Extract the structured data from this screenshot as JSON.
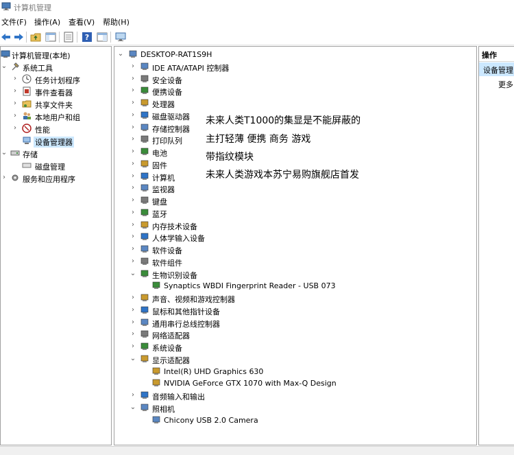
{
  "window": {
    "title": "计算机管理"
  },
  "menu": {
    "file": "文件(F)",
    "action": "操作(A)",
    "view": "查看(V)",
    "help": "帮助(H)"
  },
  "left_tree": {
    "root": "计算机管理(本地)",
    "system_tools": "系统工具",
    "task_scheduler": "任务计划程序",
    "event_viewer": "事件查看器",
    "shared_folders": "共享文件夹",
    "local_users": "本地用户和组",
    "performance": "性能",
    "device_manager": "设备管理器",
    "storage": "存储",
    "disk_management": "磁盘管理",
    "services_apps": "服务和应用程序"
  },
  "device_tree": {
    "root": "DESKTOP-RAT1S9H",
    "categories": [
      {
        "label": "IDE ATA/ATAPI 控制器",
        "expanded": false,
        "icon": "ide-controller-icon"
      },
      {
        "label": "安全设备",
        "expanded": false,
        "icon": "security-device-icon"
      },
      {
        "label": "便携设备",
        "expanded": false,
        "icon": "portable-device-icon"
      },
      {
        "label": "处理器",
        "expanded": false,
        "icon": "processor-icon"
      },
      {
        "label": "磁盘驱动器",
        "expanded": false,
        "icon": "disk-drive-icon"
      },
      {
        "label": "存储控制器",
        "expanded": false,
        "icon": "storage-controller-icon"
      },
      {
        "label": "打印队列",
        "expanded": false,
        "icon": "printer-icon"
      },
      {
        "label": "电池",
        "expanded": false,
        "icon": "battery-icon"
      },
      {
        "label": "固件",
        "expanded": false,
        "icon": "firmware-icon"
      },
      {
        "label": "计算机",
        "expanded": false,
        "icon": "computer-icon"
      },
      {
        "label": "监视器",
        "expanded": false,
        "icon": "monitor-icon"
      },
      {
        "label": "键盘",
        "expanded": false,
        "icon": "keyboard-icon"
      },
      {
        "label": "蓝牙",
        "expanded": false,
        "icon": "bluetooth-icon"
      },
      {
        "label": "内存技术设备",
        "expanded": false,
        "icon": "memory-device-icon"
      },
      {
        "label": "人体学输入设备",
        "expanded": false,
        "icon": "hid-icon"
      },
      {
        "label": "软件设备",
        "expanded": false,
        "icon": "software-device-icon"
      },
      {
        "label": "软件组件",
        "expanded": false,
        "icon": "software-component-icon"
      },
      {
        "label": "生物识别设备",
        "expanded": true,
        "icon": "biometric-icon",
        "children": [
          "Synaptics WBDI Fingerprint Reader - USB 073"
        ]
      },
      {
        "label": "声音、视频和游戏控制器",
        "expanded": false,
        "icon": "sound-icon"
      },
      {
        "label": "鼠标和其他指针设备",
        "expanded": false,
        "icon": "mouse-icon"
      },
      {
        "label": "通用串行总线控制器",
        "expanded": false,
        "icon": "usb-icon"
      },
      {
        "label": "网络适配器",
        "expanded": false,
        "icon": "network-adapter-icon"
      },
      {
        "label": "系统设备",
        "expanded": false,
        "icon": "system-device-icon"
      },
      {
        "label": "显示适配器",
        "expanded": true,
        "icon": "display-adapter-icon",
        "children": [
          "Intel(R) UHD Graphics 630",
          "NVIDIA GeForce GTX 1070 with Max-Q Design"
        ]
      },
      {
        "label": "音频输入和输出",
        "expanded": false,
        "icon": "audio-io-icon"
      },
      {
        "label": "照相机",
        "expanded": true,
        "icon": "camera-icon",
        "children": [
          "Chicony USB 2.0 Camera"
        ]
      }
    ]
  },
  "overlay_text": [
    "未来人类T1000的集显是不能屏蔽的",
    "主打轻薄 便携 商务 游戏",
    "带指纹模块",
    "未来人类游戏本苏宁易购旗舰店首发"
  ],
  "actions_panel": {
    "header": "操作",
    "selected": "设备管理",
    "more": "更多"
  },
  "colors": {
    "selection": "#cce8ff",
    "border": "#a0a0a0"
  }
}
